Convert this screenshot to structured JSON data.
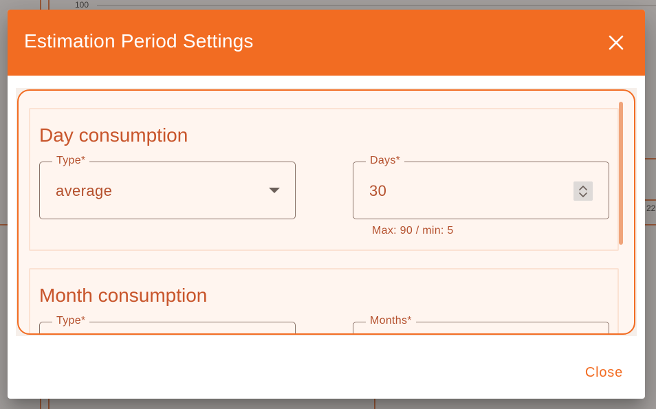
{
  "background": {
    "axis_tick": "100",
    "axis_tick_right": "22"
  },
  "dialog": {
    "title": "Estimation Period Settings",
    "close_icon": "close-icon",
    "header_color": "#f26c22",
    "accent_color": "#f26c22",
    "text_color": "#b5512e",
    "sections": [
      {
        "title": "Day consumption",
        "type_label": "Type*",
        "type_value": "average",
        "amount_label": "Days*",
        "amount_value": "30",
        "hint": "Max: 90 / min: 5"
      },
      {
        "title": "Month consumption",
        "type_label": "Type*",
        "amount_label": "Months*"
      }
    ],
    "actions": {
      "close_label": "Close"
    }
  }
}
